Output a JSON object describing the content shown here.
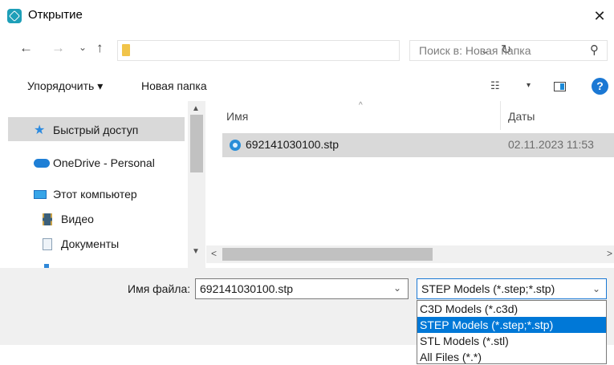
{
  "window": {
    "title": "Открытие",
    "close_glyph": "✕"
  },
  "address_bar": {
    "back_glyph": "←",
    "forward_glyph": "→",
    "recent_glyph": "⌄",
    "up_glyph": "↑",
    "dropdown_glyph": "⌄",
    "refresh_glyph": "↻",
    "search_placeholder": "Поиск в: Новая папка",
    "search_icon_glyph": "⚲"
  },
  "command_bar": {
    "organize_label": "Упорядочить ▾",
    "new_folder_label": "Новая папка",
    "view_glyph": "☷",
    "view_dropdown_glyph": "▾",
    "help_glyph": "?"
  },
  "nav_pane": {
    "items": [
      {
        "label": "Быстрый доступ",
        "icon": "star-icon"
      },
      {
        "label": "OneDrive - Personal",
        "icon": "cloud-icon"
      },
      {
        "label": "Этот компьютер",
        "icon": "computer-icon"
      },
      {
        "label": "Видео",
        "icon": "video-icon"
      },
      {
        "label": "Документы",
        "icon": "documents-icon"
      }
    ]
  },
  "file_list": {
    "columns": {
      "name": "Имя",
      "date": "Даты"
    },
    "sort_glyph": "^",
    "files": [
      {
        "name": "692141030100.stp",
        "date": "02.11.2023 11:53",
        "icon": "c3d-file-icon"
      }
    ]
  },
  "scrollbars": {
    "up_glyph": "▲",
    "down_glyph": "▼",
    "left_glyph": "<",
    "right_glyph": ">"
  },
  "bottom": {
    "filename_label": "Имя файла:",
    "filename_value": "692141030100.stp",
    "filename_dropdown_glyph": "⌄",
    "filetype_value": "STEP Models (*.step;*.stp)",
    "filetype_dropdown_glyph": "⌄",
    "filetype_options": [
      "C3D Models (*.c3d)",
      "STEP Models (*.step;*.stp)",
      "STL Models (*.stl)",
      "All Files (*.*)"
    ],
    "filetype_selected_index": 1
  },
  "colors": {
    "accent": "#0078d7",
    "selection_gray": "#d9d9d9",
    "footer_bg": "#f0f0f0"
  }
}
